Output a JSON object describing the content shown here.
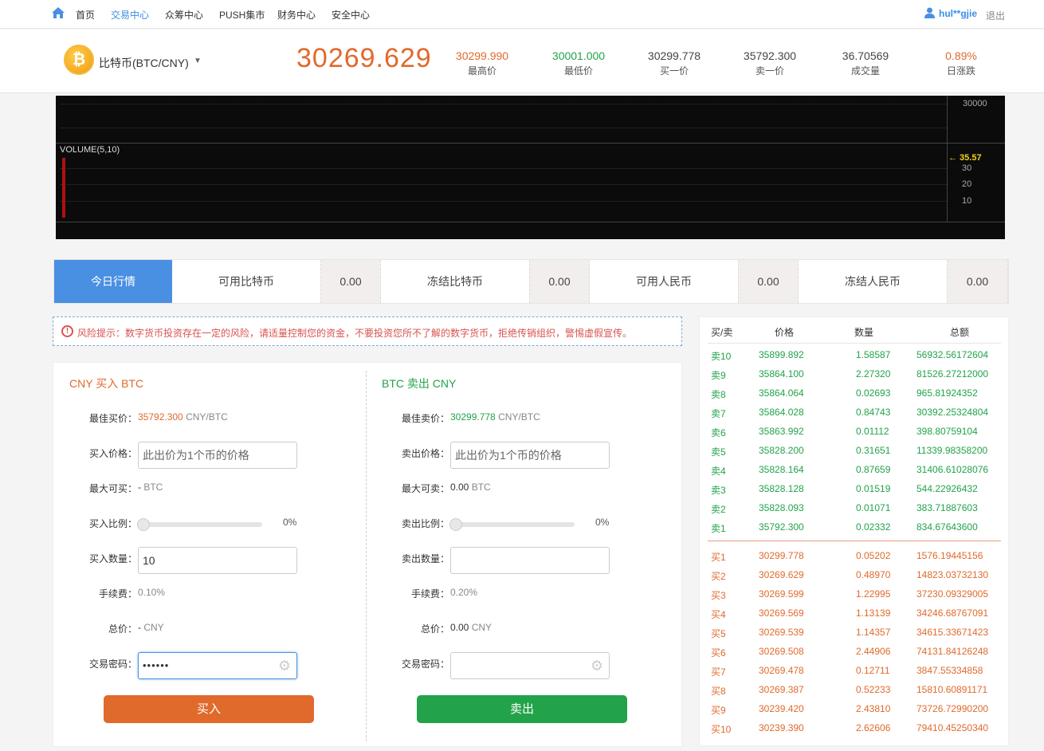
{
  "nav": {
    "items": [
      "首页",
      "交易中心",
      "众筹中心",
      "PUSH集市",
      "财务中心",
      "安全中心"
    ],
    "active_index": 1,
    "username": "hul**gjie",
    "logout": "退出"
  },
  "ticker": {
    "coin_symbol": "₿",
    "pair": "比特币(BTC/CNY)",
    "last_price": "30269.629",
    "stats": [
      {
        "value": "30299.990",
        "label": "最高价",
        "color": "#e06a2c"
      },
      {
        "value": "30001.000",
        "label": "最低价",
        "color": "#22a34a"
      },
      {
        "value": "30299.778",
        "label": "买一价",
        "color": "#444444"
      },
      {
        "value": "35792.300",
        "label": "卖一价",
        "color": "#444444"
      },
      {
        "value": "36.70569",
        "label": "成交量",
        "color": "#444444"
      },
      {
        "value": "0.89%",
        "label": "日涨跌",
        "color": "#e06a2c"
      }
    ]
  },
  "chart": {
    "price_tick": "30000",
    "volume_label": "VOLUME(5,10)",
    "last_volume": "← 35.57",
    "volume_ticks": [
      "30",
      "20",
      "10"
    ],
    "volume_bar_value": 35.57
  },
  "balance": {
    "today_tab": "今日行情",
    "items": [
      {
        "label": "可用比特币",
        "value": "0.00"
      },
      {
        "label": "冻结比特币",
        "value": "0.00"
      },
      {
        "label": "可用人民币",
        "value": "0.00"
      },
      {
        "label": "冻结人民币",
        "value": "0.00"
      }
    ]
  },
  "risk": {
    "text": "风险提示：数字货币投资存在一定的风险，请适量控制您的资金，不要投资您所不了解的数字货币，拒绝传销组织，警惕虚假宣传。"
  },
  "buy": {
    "title": "CNY 买入 BTC",
    "best_label": "最佳买价：",
    "best_price": "35792.300",
    "best_unit": "CNY/BTC",
    "price_label": "买入价格：",
    "price_placeholder": "此出价为1个币的价格",
    "max_label": "最大可买：",
    "max_value": "-",
    "max_unit": "BTC",
    "ratio_label": "买入比例：",
    "ratio_pct": "0%",
    "qty_label": "买入数量：",
    "qty_value": "10",
    "fee_label": "手续费：",
    "fee_value": "0.10%",
    "total_label": "总价：",
    "total_value": "-",
    "total_unit": "CNY",
    "pwd_label": "交易密码：",
    "pwd_value": "••••••",
    "button": "买入"
  },
  "sell": {
    "title": "BTC 卖出 CNY",
    "best_label": "最佳卖价：",
    "best_price": "30299.778",
    "best_unit": "CNY/BTC",
    "price_label": "卖出价格：",
    "price_placeholder": "此出价为1个币的价格",
    "max_label": "最大可卖：",
    "max_value": "0.00",
    "max_unit": "BTC",
    "ratio_label": "卖出比例：",
    "ratio_pct": "0%",
    "qty_label": "卖出数量：",
    "qty_value": "",
    "fee_label": "手续费：",
    "fee_value": "0.20%",
    "total_label": "总价：",
    "total_value": "0.00",
    "total_unit": "CNY",
    "pwd_label": "交易密码：",
    "pwd_value": "",
    "button": "卖出"
  },
  "orderbook": {
    "headers": [
      "买/卖",
      "价格",
      "数量",
      "总额"
    ],
    "asks": [
      [
        "卖10",
        "35899.892",
        "1.58587",
        "56932.56172604"
      ],
      [
        "卖9",
        "35864.100",
        "2.27320",
        "81526.27212000"
      ],
      [
        "卖8",
        "35864.064",
        "0.02693",
        "965.81924352"
      ],
      [
        "卖7",
        "35864.028",
        "0.84743",
        "30392.25324804"
      ],
      [
        "卖6",
        "35863.992",
        "0.01112",
        "398.80759104"
      ],
      [
        "卖5",
        "35828.200",
        "0.31651",
        "11339.98358200"
      ],
      [
        "卖4",
        "35828.164",
        "0.87659",
        "31406.61028076"
      ],
      [
        "卖3",
        "35828.128",
        "0.01519",
        "544.22926432"
      ],
      [
        "卖2",
        "35828.093",
        "0.01071",
        "383.71887603"
      ],
      [
        "卖1",
        "35792.300",
        "0.02332",
        "834.67643600"
      ]
    ],
    "bids": [
      [
        "买1",
        "30299.778",
        "0.05202",
        "1576.19445156"
      ],
      [
        "买2",
        "30269.629",
        "0.48970",
        "14823.03732130"
      ],
      [
        "买3",
        "30269.599",
        "1.22995",
        "37230.09329005"
      ],
      [
        "买4",
        "30269.569",
        "1.13139",
        "34246.68767091"
      ],
      [
        "买5",
        "30269.539",
        "1.14357",
        "34615.33671423"
      ],
      [
        "买6",
        "30269.508",
        "2.44906",
        "74131.84126248"
      ],
      [
        "买7",
        "30269.478",
        "0.12711",
        "3847.55334858"
      ],
      [
        "买8",
        "30269.387",
        "0.52233",
        "15810.60891171"
      ],
      [
        "买9",
        "30239.420",
        "2.43810",
        "73726.72990200"
      ],
      [
        "买10",
        "30239.390",
        "2.62606",
        "79410.45250340"
      ]
    ]
  },
  "colors": {
    "accent_blue": "#4a90e2",
    "buy_orange": "#e06a2c",
    "sell_green": "#22a34a"
  }
}
